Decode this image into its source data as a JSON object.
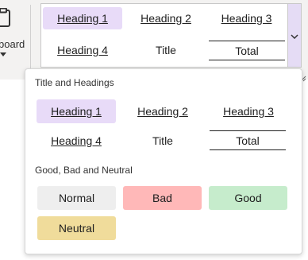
{
  "ribbon": {
    "clipboard_label": "board",
    "gallery": {
      "row1": [
        "Heading 1",
        "Heading 2",
        "Heading 3"
      ],
      "row2": [
        "Heading 4",
        "Title",
        "Total"
      ]
    }
  },
  "panel": {
    "section1": {
      "header": "Title and Headings",
      "row1": [
        "Heading 1",
        "Heading 2",
        "Heading 3"
      ],
      "row2": [
        "Heading 4",
        "Title",
        "Total"
      ]
    },
    "section2": {
      "header": "Good, Bad and Neutral",
      "items": [
        "Normal",
        "Bad",
        "Good",
        "Neutral"
      ]
    }
  },
  "colors": {
    "selected": "#e8dbf8",
    "normal": "#eeeeee",
    "bad": "#ffb8b8",
    "good": "#c6eccc",
    "neutral": "#f0dc9b"
  }
}
